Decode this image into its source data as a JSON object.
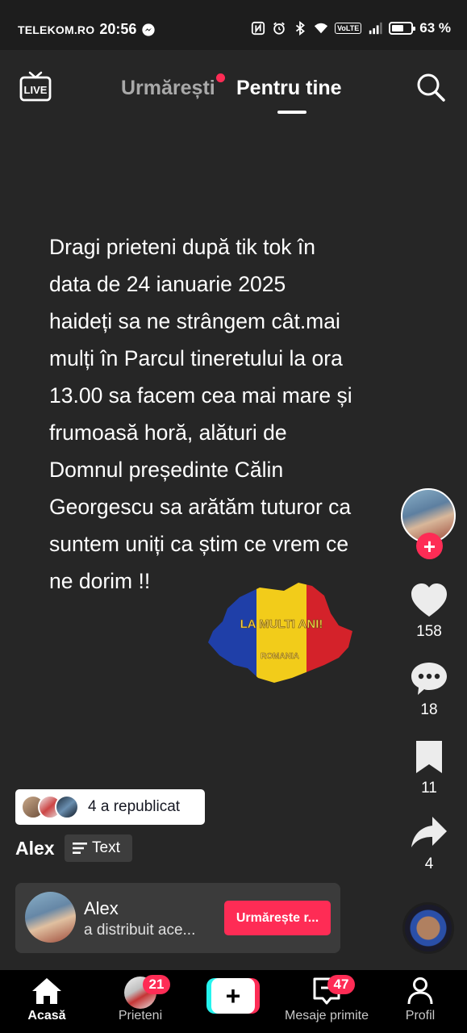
{
  "status_bar": {
    "carrier": "TELEKOM.RO",
    "time": "20:56",
    "battery": "63 %",
    "battery_level": 0.63,
    "icons": [
      "messenger-icon",
      "nfc-icon",
      "alarm-icon",
      "bluetooth-icon",
      "wifi-icon",
      "volte-icon",
      "signal-icon",
      "battery-icon"
    ],
    "volte_label": "VoLTE"
  },
  "top_nav": {
    "live_icon": "live-tv-icon",
    "live_label": "LIVE",
    "tab_following": "Urmărești",
    "tab_for_you": "Pentru tine",
    "search_icon": "search-icon"
  },
  "video": {
    "caption": "Dragi prieteni   după tik tok  în\ndata de 24 ianuarie   2025\nhaideți sa ne strângem cât.mai\nmulți în Parcul tineretului  la ora\n13.00 sa facem cea mai mare și\nfrumoasă horă, alături de\nDomnul președinte  Călin\nGeorgescu   sa arătăm tuturor ca\nsuntem uniți ca știm ce vrem ce\nne dorim !!",
    "map_text_1": "LA MULTI ANI!",
    "map_text_2": "ROMANIA"
  },
  "actions": {
    "likes": "158",
    "comments": "18",
    "saves": "11",
    "shares": "4",
    "follow_symbol": "+"
  },
  "repost": {
    "text": "4 a republicat"
  },
  "author": {
    "name": "Alex",
    "text_tag": "Text"
  },
  "share_banner": {
    "name": "Alex",
    "subtitle": "a distribuit ace...",
    "button": "Urmărește r..."
  },
  "bottom_nav": {
    "home": "Acasă",
    "friends": "Prieteni",
    "friends_badge": "21",
    "create_symbol": "+",
    "inbox": "Mesaje primite",
    "inbox_badge": "47",
    "profile": "Profil"
  },
  "colors": {
    "background": "#262626",
    "accent": "#fe2c55",
    "cyan": "#25f4ee"
  }
}
